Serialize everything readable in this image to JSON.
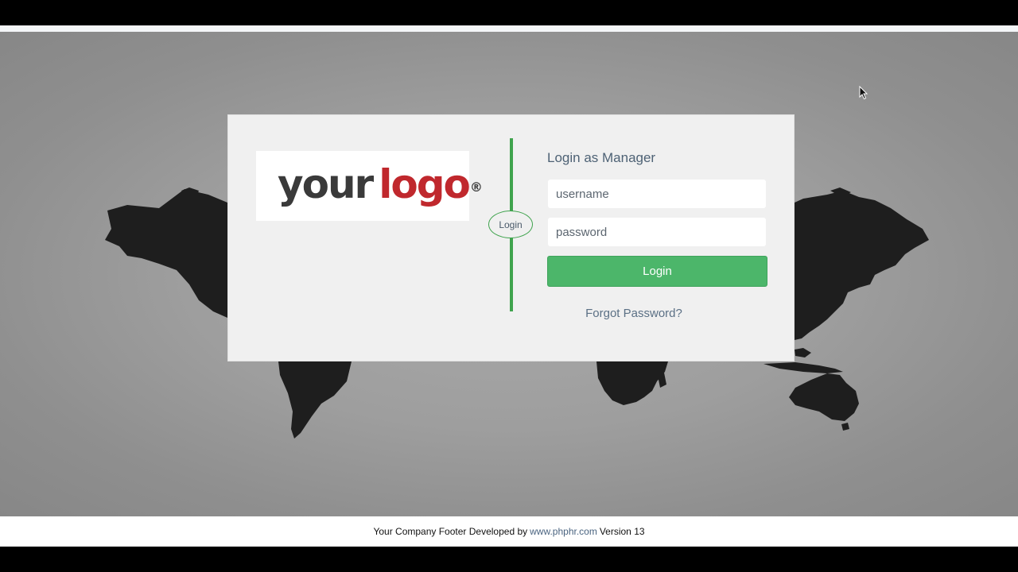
{
  "logo": {
    "word_your": "your",
    "word_logo": "logo",
    "registered_mark": "®"
  },
  "divider": {
    "badge_label": "Login"
  },
  "form": {
    "title": "Login as Manager",
    "username_placeholder": "username",
    "username_value": "",
    "password_placeholder": "password",
    "password_value": "",
    "login_button_label": "Login",
    "forgot_password_label": "Forgot Password?"
  },
  "footer": {
    "prefix": "Your Company Footer Developed by",
    "link_text": "www.phphr.com",
    "suffix": "Version 13"
  },
  "colors": {
    "accent_green": "#4cb66a",
    "divider_green": "#3fa34d",
    "logo_red": "#c0282d",
    "map_land": "#1e1e1e"
  },
  "icons": {
    "background": "world-map-icon",
    "pointer": "mouse-cursor-icon"
  }
}
